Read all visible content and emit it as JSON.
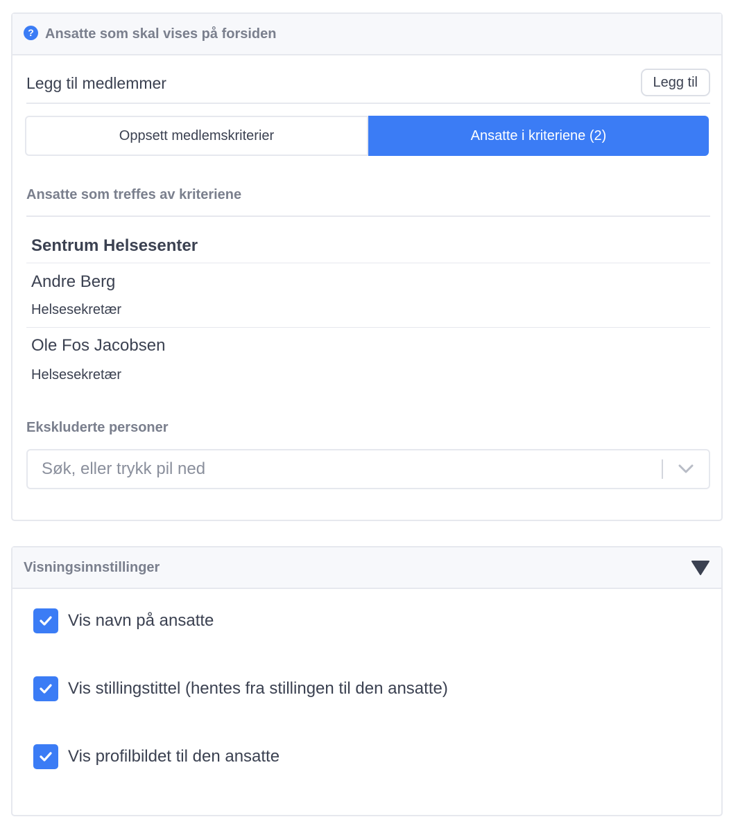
{
  "members_panel": {
    "title": "Ansatte som skal vises på forsiden",
    "help_icon": "question-circle-icon",
    "add_members_label": "Legg til medlemmer",
    "add_button_label": "Legg til",
    "tabs": [
      {
        "label": "Oppsett medlemskriterier",
        "active": false
      },
      {
        "label": "Ansatte i kriteriene (2)",
        "active": true
      }
    ],
    "matched_section_label": "Ansatte som treffes av kriteriene",
    "unit_name": "Sentrum Helsesenter",
    "employees": [
      {
        "name": "Andre Berg",
        "title": "Helsesekretær"
      },
      {
        "name": "Ole Fos Jacobsen",
        "title": "Helsesekretær"
      }
    ],
    "excluded_section_label": "Ekskluderte personer",
    "excluded_search_placeholder": "Søk, eller trykk pil ned",
    "excluded_search_value": ""
  },
  "display_panel": {
    "title": "Visningsinnstillinger",
    "collapse_icon": "triangle-down-icon",
    "options": [
      {
        "label": "Vis navn på ansatte",
        "checked": true
      },
      {
        "label": "Vis stillingstittel (hentes fra stillingen til den ansatte)",
        "checked": true
      },
      {
        "label": "Vis profilbildet til den ansatte",
        "checked": true
      }
    ]
  },
  "colors": {
    "accent": "#3b7cf5",
    "border": "#e6e8ee",
    "header_bg": "#f7f8fb",
    "muted_text": "#7a7f8d",
    "text": "#3b4151"
  }
}
